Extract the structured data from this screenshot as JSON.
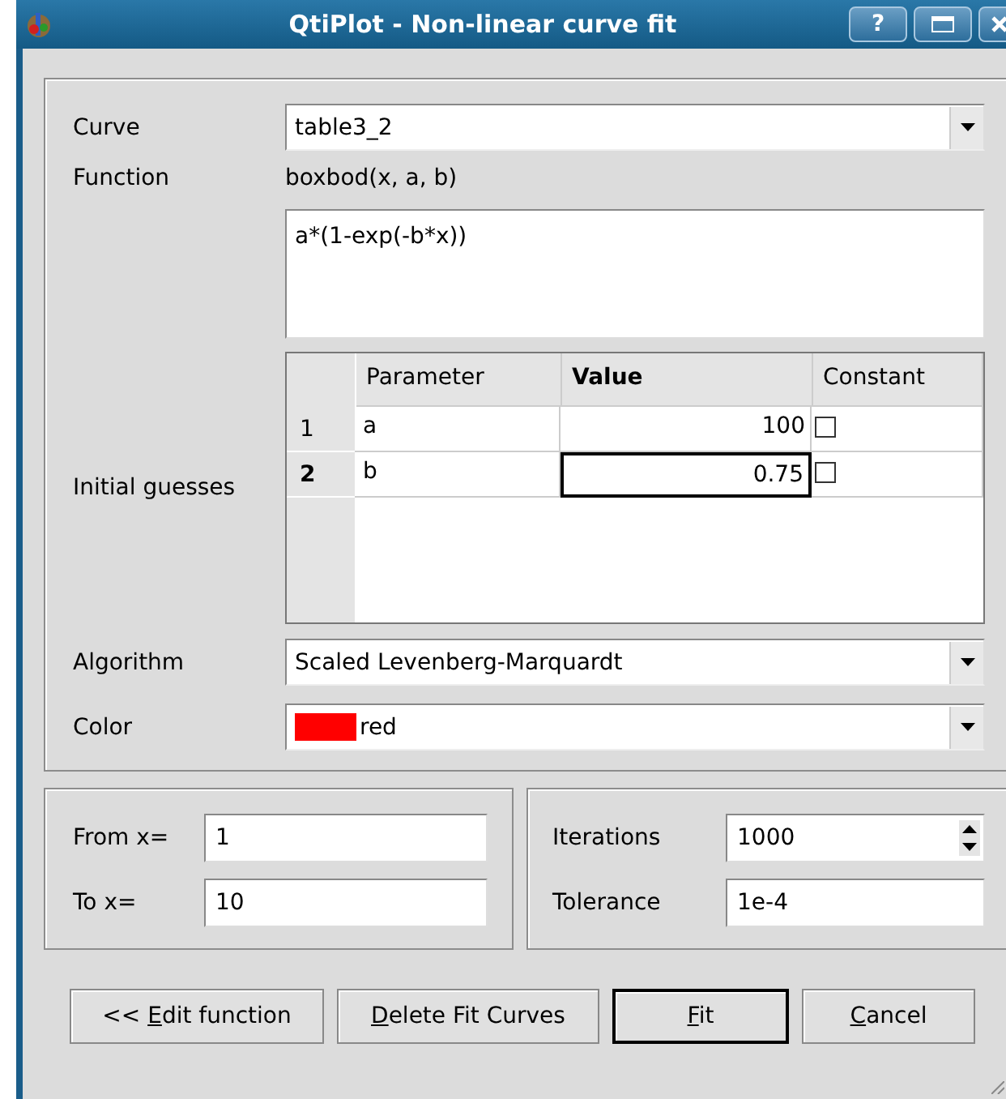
{
  "window": {
    "title": "QtiPlot - Non-linear curve fit",
    "help_button": "?"
  },
  "curve": {
    "label": "Curve",
    "value": "table3_2"
  },
  "function": {
    "label": "Function",
    "name": "boxbod(x, a, b)",
    "formula": "a*(1-exp(-b*x))"
  },
  "initial_guesses": {
    "label": "Initial guesses",
    "columns": [
      {
        "label": "Parameter",
        "bold": false
      },
      {
        "label": "Value",
        "bold": true
      },
      {
        "label": "Constant",
        "bold": false
      }
    ],
    "rows": [
      {
        "index": "1",
        "parameter": "a",
        "value": "100",
        "constant": false,
        "selected": false
      },
      {
        "index": "2",
        "parameter": "b",
        "value": "0.75",
        "constant": false,
        "selected": true
      }
    ]
  },
  "algorithm": {
    "label": "Algorithm",
    "value": "Scaled Levenberg-Marquardt"
  },
  "color": {
    "label": "Color",
    "value": "red",
    "color": "#ff0000"
  },
  "range": [
    {
      "label": "From x=",
      "value": "1"
    },
    {
      "label": "To x=",
      "value": "10"
    }
  ],
  "iterations": {
    "label": "Iterations",
    "value": "1000"
  },
  "tolerance": {
    "label": "Tolerance",
    "value": "1e-4"
  },
  "buttons": [
    {
      "label_before": "<< ",
      "access_key": "E",
      "label_after": "dit function",
      "default": false
    },
    {
      "access_key": "D",
      "label_after": "elete Fit Curves",
      "default": false
    },
    {
      "access_key": "F",
      "label_after": "it",
      "default": true
    },
    {
      "access_key": "C",
      "label_after": "ancel",
      "default": false
    }
  ]
}
